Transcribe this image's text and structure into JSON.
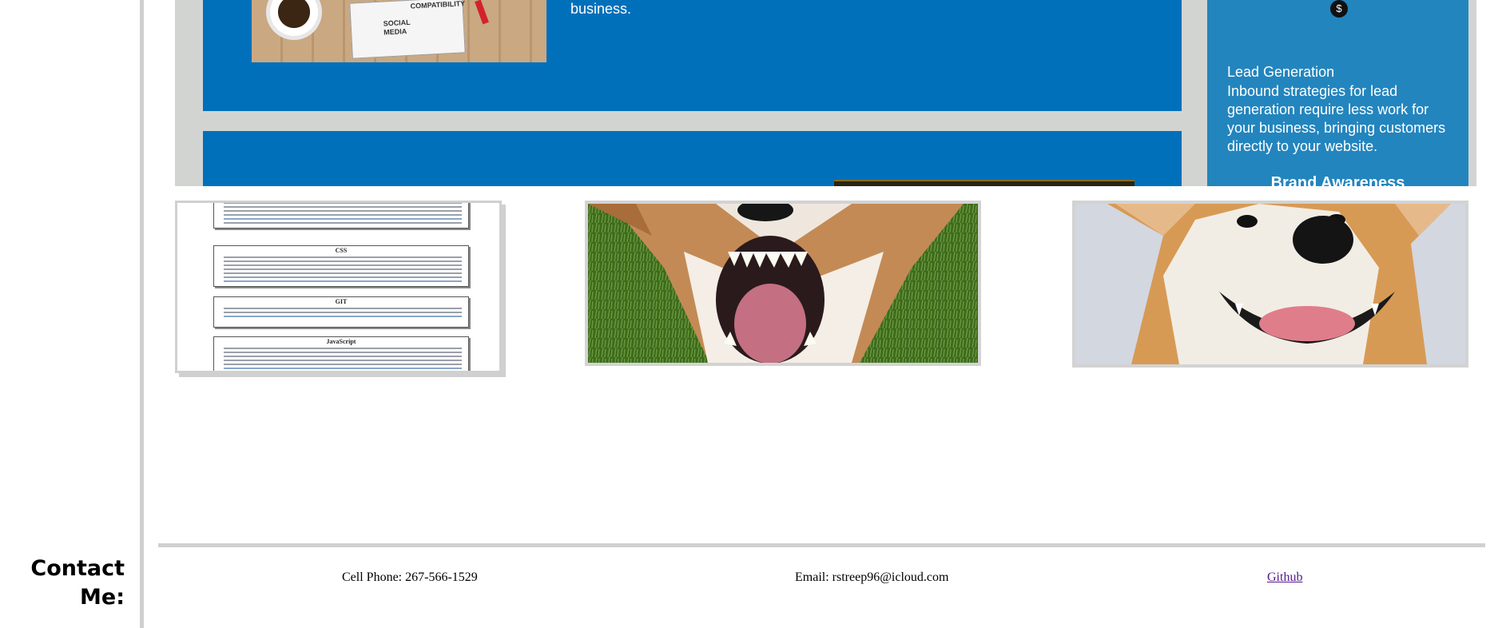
{
  "projects": {
    "marketing_site": {
      "business_text": "business.",
      "notebook_words": [
        "COMPATIBILITY",
        "SOCIAL",
        "MEDIA"
      ],
      "lead_generation": {
        "title": "Lead Generation",
        "body": "Inbound strategies for lead generation require less work for your business, bringing customers directly to your website."
      },
      "brand_awareness_title": "Brand Awareness",
      "dollar_icon_glyph": "$",
      "colors": {
        "card_blue": "#0170bb",
        "side_blue": "#2385be",
        "frame_gray": "#d2d4d2"
      }
    },
    "resume_doc": {
      "sections": [
        "CSS",
        "GIT",
        "JavaScript"
      ]
    },
    "corgi_images": [
      "angry-corgi",
      "smiling-corgi"
    ]
  },
  "contact": {
    "heading": "Contact Me:",
    "cell_phone": "Cell Phone: 267-566-1529",
    "email": "Email: rstreep96@icloud.com",
    "github": "Github"
  }
}
